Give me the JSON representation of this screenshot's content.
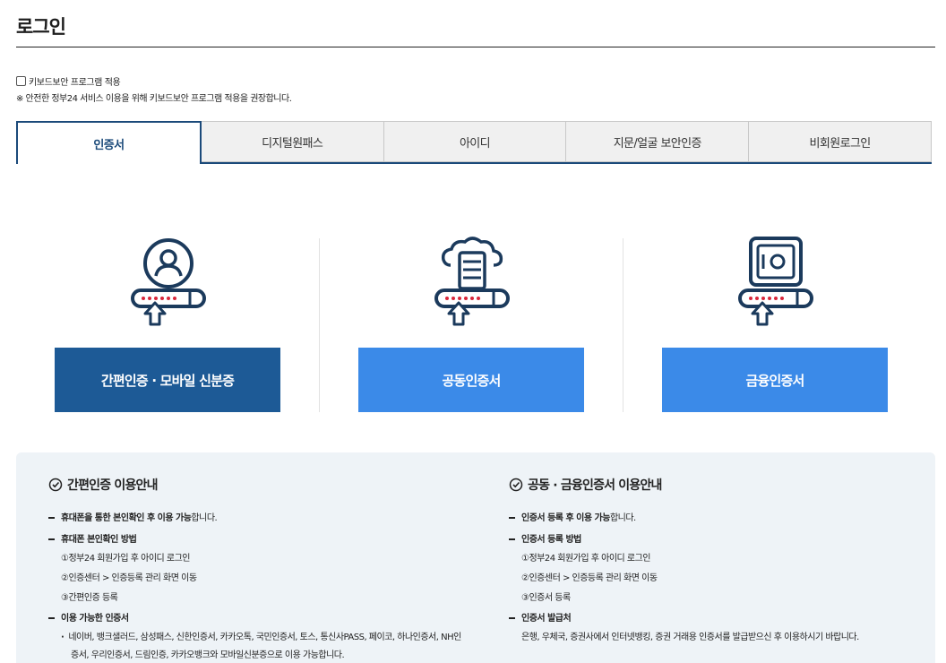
{
  "page": {
    "title": "로그인"
  },
  "keyboard_security": {
    "label": "키보드보안 프로그램 적용",
    "notice": "※ 안전한 정부24 서비스 이용을 위해 키보드보안 프로그램 적용을 권장합니다."
  },
  "tabs": [
    {
      "label": "인증서",
      "active": true
    },
    {
      "label": "디지털원패스",
      "active": false
    },
    {
      "label": "아이디",
      "active": false
    },
    {
      "label": "지문/얼굴 보안인증",
      "active": false
    },
    {
      "label": "비회원로그인",
      "active": false
    }
  ],
  "cert_options": [
    {
      "label": "간편인증 · 모바일 신분증",
      "icon": "user-key-icon"
    },
    {
      "label": "공동인증서",
      "icon": "cloud-server-key-icon"
    },
    {
      "label": "금융인증서",
      "icon": "safe-key-icon"
    }
  ],
  "colors": {
    "primary_dark": "#1d5a96",
    "primary_light": "#3b8ae8",
    "icon_navy": "#1b3a5c",
    "icon_red": "#d9263a",
    "info_bg": "#eef3f7"
  },
  "simple_info": {
    "title": "간편인증 이용안내",
    "line1_bold": "휴대폰을 통한 본인확인 후 이용 가능",
    "line1_rest": "합니다.",
    "method_title": "휴대폰 본인확인 방법",
    "steps": [
      "①정부24 회원가입 후 아이디 로그인",
      "②인증센터 > 인증등록 관리 화면 이동",
      "③간편인증 등록"
    ],
    "available_title": "이용 가능한 인증서",
    "available_line1": "네이버, 뱅크샐러드, 삼성패스, 신한인증서, 카카오톡, 국민인증서, 토스, 통신사PASS, 페이코, 하나인증서, NH인",
    "available_line2": "증서, 우리인증서, 드림인증, 카카오뱅크와 모바일신분증으로 이용 가능합니다."
  },
  "joint_info": {
    "title": "공동 · 금융인증서 이용안내",
    "line1_bold": "인증서 등록 후 이용 가능",
    "line1_rest": "합니다.",
    "register_title": "인증서 등록 방법",
    "steps": [
      "①정부24 회원가입 후 아이디 로그인",
      "②인증센터 > 인증등록 관리 화면 이동",
      "③인증서 등록"
    ],
    "issue_title": "인증서 발급처",
    "issue_text": "은행, 우체국, 증권사에서 인터넷뱅킹, 증권 거래용 인증서를 발급받으신 후 이용하시기 바랍니다."
  }
}
